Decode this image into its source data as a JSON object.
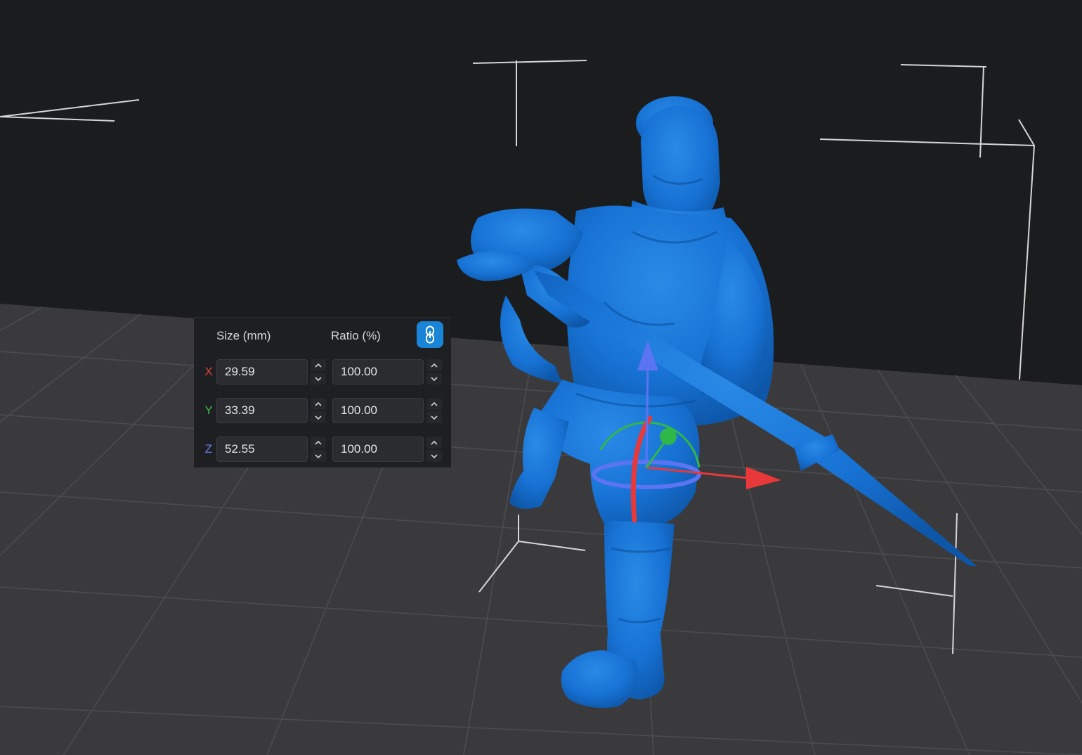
{
  "viewport": {
    "background": "#1b1c1e",
    "plate_color": "#3a3a3c",
    "grid_color": "#4c4d50",
    "model_color": "#1772d4",
    "gizmo": {
      "x_axis_color": "#e8383a",
      "y_axis_color": "#2fb84a",
      "z_axis_color": "#5b74f2"
    }
  },
  "scale_panel": {
    "size_header": "Size (mm)",
    "ratio_header": "Ratio (%)",
    "lock_icon": "link-icon",
    "lock_color": "#1a84d6",
    "rows": [
      {
        "axis": "X",
        "color": "#e0413a",
        "size": "29.59",
        "ratio": "100.00"
      },
      {
        "axis": "Y",
        "color": "#3cba4c",
        "size": "33.39",
        "ratio": "100.00"
      },
      {
        "axis": "Z",
        "color": "#6b7de8",
        "size": "52.55",
        "ratio": "100.00"
      }
    ]
  }
}
